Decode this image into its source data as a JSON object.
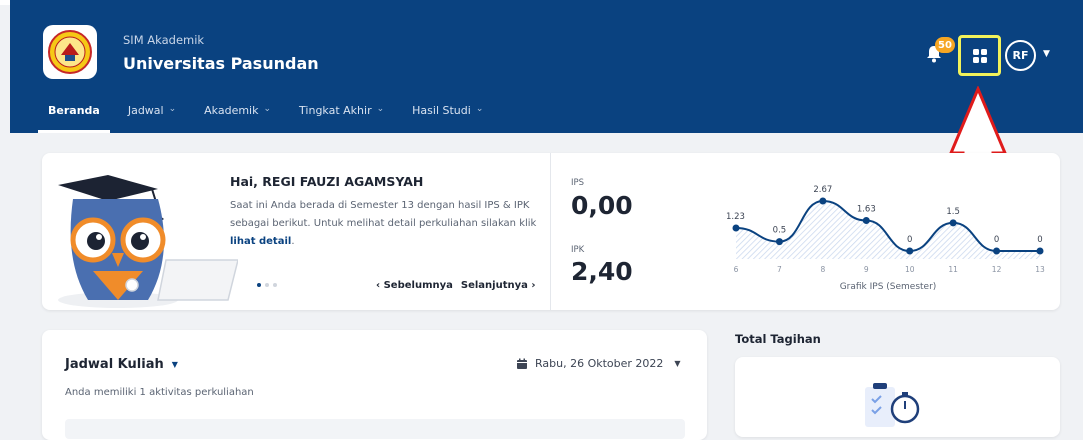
{
  "header": {
    "app_sub": "SIM Akademik",
    "app_title": "Universitas Pasundan",
    "notification_count": "50",
    "avatar_initials": "RF"
  },
  "nav": [
    {
      "label": "Beranda",
      "active": true,
      "has_menu": false
    },
    {
      "label": "Jadwal",
      "active": false,
      "has_menu": true
    },
    {
      "label": "Akademik",
      "active": false,
      "has_menu": true
    },
    {
      "label": "Tingkat Akhir",
      "active": false,
      "has_menu": true
    },
    {
      "label": "Hasil Studi",
      "active": false,
      "has_menu": true
    }
  ],
  "welcome": {
    "greeting": "Hai, REGI FAUZI AGAMSYAH",
    "description_prefix": "Saat ini Anda berada di Semester 13 dengan hasil IPS & IPK sebagai berikut. Untuk melihat detail perkuliahan silakan klik ",
    "detail_link": "lihat detail",
    "description_suffix": ".",
    "prev_label": "‹ Sebelumnya",
    "next_label": "Selanjutnya ›"
  },
  "stats": {
    "ips_label": "IPS",
    "ips_value": "0,00",
    "ipk_label": "IPK",
    "ipk_value": "2,40"
  },
  "chart_data": {
    "type": "area",
    "xlabel": "Grafik IPS (Semester)",
    "x": [
      "6",
      "7",
      "8",
      "9",
      "10",
      "11",
      "12",
      "13"
    ],
    "values": [
      1.23,
      0.5,
      2.67,
      1.63,
      0,
      1.5,
      0,
      0
    ],
    "value_labels": [
      "1.23",
      "0.5",
      "2.67",
      "1.63",
      "0",
      "1.5",
      "0",
      "0"
    ],
    "color": "#0a4280"
  },
  "jadwal": {
    "title": "Jadwal Kuliah",
    "date": "Rabu, 26 Oktober 2022",
    "subtitle": "Anda memiliki 1 aktivitas perkuliahan"
  },
  "tagihan": {
    "title": "Total Tagihan"
  },
  "colors": {
    "header_bg": "#0a4280",
    "badge": "#f6a623",
    "highlight_box": "#f2f25a",
    "annotation_arrow": "#e01b1b"
  },
  "icons": [
    "bell-icon",
    "apps-grid-icon",
    "calendar-icon",
    "owl-mascot-illustration",
    "university-logo",
    "up-arrow-annotation",
    "stopwatch-illustration"
  ]
}
